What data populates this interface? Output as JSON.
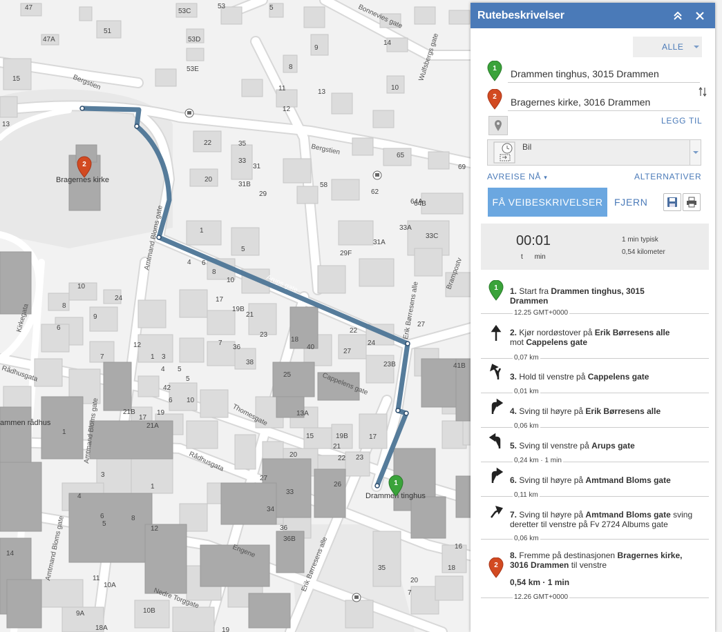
{
  "map": {
    "place_labels": {
      "bragernes_kirke": "Bragernes kirke",
      "drammen_tinghus": "Drammen tinghus",
      "drammen_radhus": "ammen rådhus"
    },
    "streets": {
      "bergstien_top": "Bergstien",
      "bergstien_mid": "Bergstien",
      "bonnevies_gate": "Bonnevies gate",
      "wulfsbergs_gate": "Wulfsbergs gate",
      "amtmand_bloms_gate_upper": "Amtmand Bloms gate",
      "amtmand_bloms_gate_mid": "Amtmand Bloms gate",
      "amtmand_bloms_gate_low": "Amtmand Bloms gate",
      "arups_gate": "Arups gate",
      "erik_borresens_alle_upper": "Erik Børresens alle",
      "erik_borresens_alle_low": "Erik Børresens alle",
      "cappelens_gate": "Cappelens gate",
      "thomesgate": "Thomesgate",
      "radhusgata_left": "Rådhusgata",
      "radhusgata_mid": "Rådhusgata",
      "kirkegata": "Kirkegata",
      "engene": "Engene",
      "nedre_torggate": "Nedre Torggate",
      "brampostveien": "Brampostv"
    },
    "house_numbers": [
      "47",
      "51",
      "47A",
      "15",
      "13",
      "53C",
      "53D",
      "53E",
      "53",
      "5",
      "9",
      "8",
      "11",
      "13",
      "10",
      "12",
      "14",
      "65",
      "69",
      "22",
      "35",
      "33",
      "31",
      "31B",
      "29",
      "20",
      "1",
      "58",
      "62",
      "64A",
      "64B",
      "33A",
      "33C",
      "31A",
      "29F",
      "5",
      "4",
      "6",
      "8",
      "10",
      "17",
      "19B",
      "21",
      "23",
      "18",
      "22",
      "24",
      "23B",
      "27",
      "41B",
      "10",
      "24",
      "8",
      "9",
      "6",
      "7",
      "12",
      "1",
      "3",
      "4",
      "5",
      "7",
      "36",
      "38",
      "40",
      "27",
      "25",
      "42",
      "6",
      "5",
      "21B",
      "17",
      "19",
      "21A",
      "10",
      "13A",
      "15",
      "19B",
      "21",
      "17",
      "23",
      "20",
      "27",
      "22",
      "33",
      "26",
      "34",
      "36B",
      "36",
      "35",
      "1",
      "3",
      "5",
      "4",
      "6",
      "8",
      "12",
      "14",
      "11",
      "10A",
      "10B",
      "19",
      "18A",
      "9A",
      "7",
      "16",
      "18",
      "20",
      "1"
    ]
  },
  "route_pins": {
    "start_number": "1",
    "end_number": "2"
  },
  "panel": {
    "title": "Rutebeskrivelser",
    "collapse_icon": "double-chevron-up-icon",
    "close_icon": "close-icon",
    "alle_label": "ALLE",
    "stops": [
      {
        "number": "1",
        "value": "Drammen tinghus, 3015 Drammen",
        "color": "#3aa33a"
      },
      {
        "number": "2",
        "value": "Bragernes kirke, 3016 Drammen",
        "color": "#d24a21"
      }
    ],
    "swap_icon": "swap-arrows-icon",
    "legg_til": "LEGG TIL",
    "mode": "Bil",
    "avreise": "AVREISE NÅ",
    "alternativer": "ALTERNATIVER",
    "go_button": "FÅ VEIBESKRIVELSER",
    "fjern": "FJERN",
    "save_icon": "save-icon",
    "print_icon": "print-icon"
  },
  "summary": {
    "time": "00:01",
    "unit_hours": "t",
    "unit_minutes": "min",
    "typical": "1 min typisk",
    "distance": "0,54 kilometer"
  },
  "steps": [
    {
      "num": "1.",
      "parts": [
        "Start fra ",
        "Drammen tinghus, 3015 Drammen"
      ],
      "meta": "12.25 GMT+0000",
      "icon": "start-pin-icon"
    },
    {
      "num": "2.",
      "parts": [
        "Kjør nordøstover på ",
        "Erik Børresens alle",
        " mot ",
        "Cappelens gate"
      ],
      "meta": "0,07 km",
      "icon": "straight-arrow-icon"
    },
    {
      "num": "3.",
      "parts": [
        "Hold til venstre på ",
        "Cappelens gate"
      ],
      "meta": "0,01 km",
      "icon": "keep-left-icon"
    },
    {
      "num": "4.",
      "parts": [
        "Sving til høyre på ",
        "Erik Børresens alle"
      ],
      "meta": "0,06 km",
      "icon": "turn-right-icon"
    },
    {
      "num": "5.",
      "parts": [
        "Sving til venstre på ",
        "Arups gate"
      ],
      "meta": "0,24 km · 1 min",
      "icon": "turn-left-icon"
    },
    {
      "num": "6.",
      "parts": [
        "Sving til høyre på ",
        "Amtmand Bloms gate"
      ],
      "meta": "0,11 km",
      "icon": "turn-right-icon"
    },
    {
      "num": "7.",
      "parts": [
        "Sving til høyre på ",
        "Amtmand Bloms gate",
        "  sving deretter til venstre på Fv 2724 Albums gate"
      ],
      "meta": "0,06 km",
      "icon": "right-then-left-icon"
    },
    {
      "num": "8.",
      "parts": [
        "Fremme på destinasjonen ",
        "Bragernes kirke, 3016 Drammen",
        "  til venstre"
      ],
      "total": "0,54 km · 1 min",
      "meta": "12.26 GMT+0000",
      "icon": "end-pin-icon"
    }
  ],
  "colors": {
    "header": "#4a7ab8",
    "link": "#4a7ab8",
    "go_button": "#6ba7e0",
    "route": "#4d7596",
    "pin_green": "#3aa33a",
    "pin_red": "#d24a21"
  }
}
